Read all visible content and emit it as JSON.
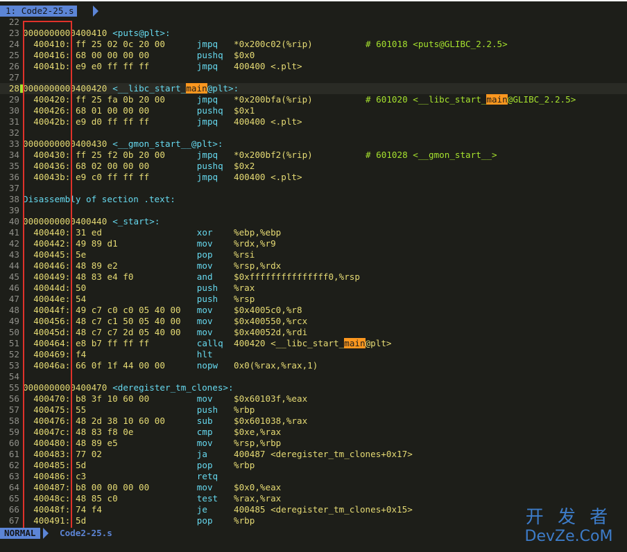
{
  "window": {
    "tab_label": "1: Code2-25.s"
  },
  "status": {
    "mode": "NORMAL",
    "filename": "Code2-25.s"
  },
  "watermark": {
    "line1": "开 发 者",
    "line2": "DevZe.CoM"
  },
  "colors": {
    "accent": "#5c85d6",
    "annotation_box": "#e0322a",
    "highlight": "#fd971f",
    "background": "#1d1e19"
  },
  "current_line": 28,
  "lines": [
    {
      "n": "22",
      "kind": "blank"
    },
    {
      "n": "23",
      "kind": "head",
      "text": "0000000000400410",
      "label": "<puts@plt>:"
    },
    {
      "n": "24",
      "kind": "ins",
      "addr": "400410",
      "bytes": "ff 25 02 0c 20 00",
      "mn": "jmpq",
      "op": "*0x200c02(%rip)",
      "cm": "# 601018 <puts@GLIBC_2.2.5>"
    },
    {
      "n": "25",
      "kind": "ins",
      "addr": "400416",
      "bytes": "68 00 00 00 00",
      "mn": "pushq",
      "op": "$0x0",
      "cm": ""
    },
    {
      "n": "26",
      "kind": "ins",
      "addr": "40041b",
      "bytes": "e9 e0 ff ff ff",
      "mn": "jmpq",
      "op": "400400 <.plt>",
      "cm": ""
    },
    {
      "n": "27",
      "kind": "blank"
    },
    {
      "n": "28",
      "kind": "head",
      "text": "0000000000400420",
      "label": "<__libc_start_main@plt>:"
    },
    {
      "n": "29",
      "kind": "ins",
      "addr": "400420",
      "bytes": "ff 25 fa 0b 20 00",
      "mn": "jmpq",
      "op": "*0x200bfa(%rip)",
      "cm": "# 601020 <__libc_start_main@GLIBC_2.2.5>"
    },
    {
      "n": "30",
      "kind": "ins",
      "addr": "400426",
      "bytes": "68 01 00 00 00",
      "mn": "pushq",
      "op": "$0x1",
      "cm": ""
    },
    {
      "n": "31",
      "kind": "ins",
      "addr": "40042b",
      "bytes": "e9 d0 ff ff ff",
      "mn": "jmpq",
      "op": "400400 <.plt>",
      "cm": ""
    },
    {
      "n": "32",
      "kind": "blank"
    },
    {
      "n": "33",
      "kind": "head",
      "text": "0000000000400430",
      "label": "<__gmon_start__@plt>:"
    },
    {
      "n": "34",
      "kind": "ins",
      "addr": "400430",
      "bytes": "ff 25 f2 0b 20 00",
      "mn": "jmpq",
      "op": "*0x200bf2(%rip)",
      "cm": "# 601028 <__gmon_start__>"
    },
    {
      "n": "35",
      "kind": "ins",
      "addr": "400436",
      "bytes": "68 02 00 00 00",
      "mn": "pushq",
      "op": "$0x2",
      "cm": ""
    },
    {
      "n": "36",
      "kind": "ins",
      "addr": "40043b",
      "bytes": "e9 c0 ff ff ff",
      "mn": "jmpq",
      "op": "400400 <.plt>",
      "cm": ""
    },
    {
      "n": "37",
      "kind": "blank"
    },
    {
      "n": "38",
      "kind": "section",
      "text": "Disassembly of section .text:"
    },
    {
      "n": "39",
      "kind": "blank"
    },
    {
      "n": "40",
      "kind": "head",
      "text": "0000000000400440",
      "label": "<_start>:"
    },
    {
      "n": "41",
      "kind": "ins",
      "addr": "400440",
      "bytes": "31 ed",
      "mn": "xor",
      "op": "%ebp,%ebp",
      "cm": ""
    },
    {
      "n": "42",
      "kind": "ins",
      "addr": "400442",
      "bytes": "49 89 d1",
      "mn": "mov",
      "op": "%rdx,%r9",
      "cm": ""
    },
    {
      "n": "43",
      "kind": "ins",
      "addr": "400445",
      "bytes": "5e",
      "mn": "pop",
      "op": "%rsi",
      "cm": ""
    },
    {
      "n": "44",
      "kind": "ins",
      "addr": "400446",
      "bytes": "48 89 e2",
      "mn": "mov",
      "op": "%rsp,%rdx",
      "cm": ""
    },
    {
      "n": "45",
      "kind": "ins",
      "addr": "400449",
      "bytes": "48 83 e4 f0",
      "mn": "and",
      "op": "$0xfffffffffffffff0,%rsp",
      "cm": ""
    },
    {
      "n": "46",
      "kind": "ins",
      "addr": "40044d",
      "bytes": "50",
      "mn": "push",
      "op": "%rax",
      "cm": ""
    },
    {
      "n": "47",
      "kind": "ins",
      "addr": "40044e",
      "bytes": "54",
      "mn": "push",
      "op": "%rsp",
      "cm": ""
    },
    {
      "n": "48",
      "kind": "ins",
      "addr": "40044f",
      "bytes": "49 c7 c0 c0 05 40 00",
      "mn": "mov",
      "op": "$0x4005c0,%r8",
      "cm": ""
    },
    {
      "n": "49",
      "kind": "ins",
      "addr": "400456",
      "bytes": "48 c7 c1 50 05 40 00",
      "mn": "mov",
      "op": "$0x400550,%rcx",
      "cm": ""
    },
    {
      "n": "50",
      "kind": "ins",
      "addr": "40045d",
      "bytes": "48 c7 c7 2d 05 40 00",
      "mn": "mov",
      "op": "$0x40052d,%rdi",
      "cm": ""
    },
    {
      "n": "51",
      "kind": "ins",
      "addr": "400464",
      "bytes": "e8 b7 ff ff ff",
      "mn": "callq",
      "op": "400420 <__libc_start_main@plt>",
      "cm": ""
    },
    {
      "n": "52",
      "kind": "ins",
      "addr": "400469",
      "bytes": "f4",
      "mn": "hlt",
      "op": "",
      "cm": ""
    },
    {
      "n": "53",
      "kind": "ins",
      "addr": "40046a",
      "bytes": "66 0f 1f 44 00 00",
      "mn": "nopw",
      "op": "0x0(%rax,%rax,1)",
      "cm": ""
    },
    {
      "n": "54",
      "kind": "blank"
    },
    {
      "n": "55",
      "kind": "head",
      "text": "0000000000400470",
      "label": "<deregister_tm_clones>:"
    },
    {
      "n": "56",
      "kind": "ins",
      "addr": "400470",
      "bytes": "b8 3f 10 60 00",
      "mn": "mov",
      "op": "$0x60103f,%eax",
      "cm": ""
    },
    {
      "n": "57",
      "kind": "ins",
      "addr": "400475",
      "bytes": "55",
      "mn": "push",
      "op": "%rbp",
      "cm": ""
    },
    {
      "n": "58",
      "kind": "ins",
      "addr": "400476",
      "bytes": "48 2d 38 10 60 00",
      "mn": "sub",
      "op": "$0x601038,%rax",
      "cm": ""
    },
    {
      "n": "59",
      "kind": "ins",
      "addr": "40047c",
      "bytes": "48 83 f8 0e",
      "mn": "cmp",
      "op": "$0xe,%rax",
      "cm": ""
    },
    {
      "n": "60",
      "kind": "ins",
      "addr": "400480",
      "bytes": "48 89 e5",
      "mn": "mov",
      "op": "%rsp,%rbp",
      "cm": ""
    },
    {
      "n": "61",
      "kind": "ins",
      "addr": "400483",
      "bytes": "77 02",
      "mn": "ja",
      "op": "400487 <deregister_tm_clones+0x17>",
      "cm": ""
    },
    {
      "n": "62",
      "kind": "ins",
      "addr": "400485",
      "bytes": "5d",
      "mn": "pop",
      "op": "%rbp",
      "cm": ""
    },
    {
      "n": "63",
      "kind": "ins",
      "addr": "400486",
      "bytes": "c3",
      "mn": "retq",
      "op": "",
      "cm": ""
    },
    {
      "n": "64",
      "kind": "ins",
      "addr": "400487",
      "bytes": "b8 00 00 00 00",
      "mn": "mov",
      "op": "$0x0,%eax",
      "cm": ""
    },
    {
      "n": "65",
      "kind": "ins",
      "addr": "40048c",
      "bytes": "48 85 c0",
      "mn": "test",
      "op": "%rax,%rax",
      "cm": ""
    },
    {
      "n": "66",
      "kind": "ins",
      "addr": "40048f",
      "bytes": "74 f4",
      "mn": "je",
      "op": "400485 <deregister_tm_clones+0x15>",
      "cm": ""
    },
    {
      "n": "67",
      "kind": "ins",
      "addr": "400491",
      "bytes": "5d",
      "mn": "pop",
      "op": "%rbp",
      "cm": ""
    }
  ]
}
